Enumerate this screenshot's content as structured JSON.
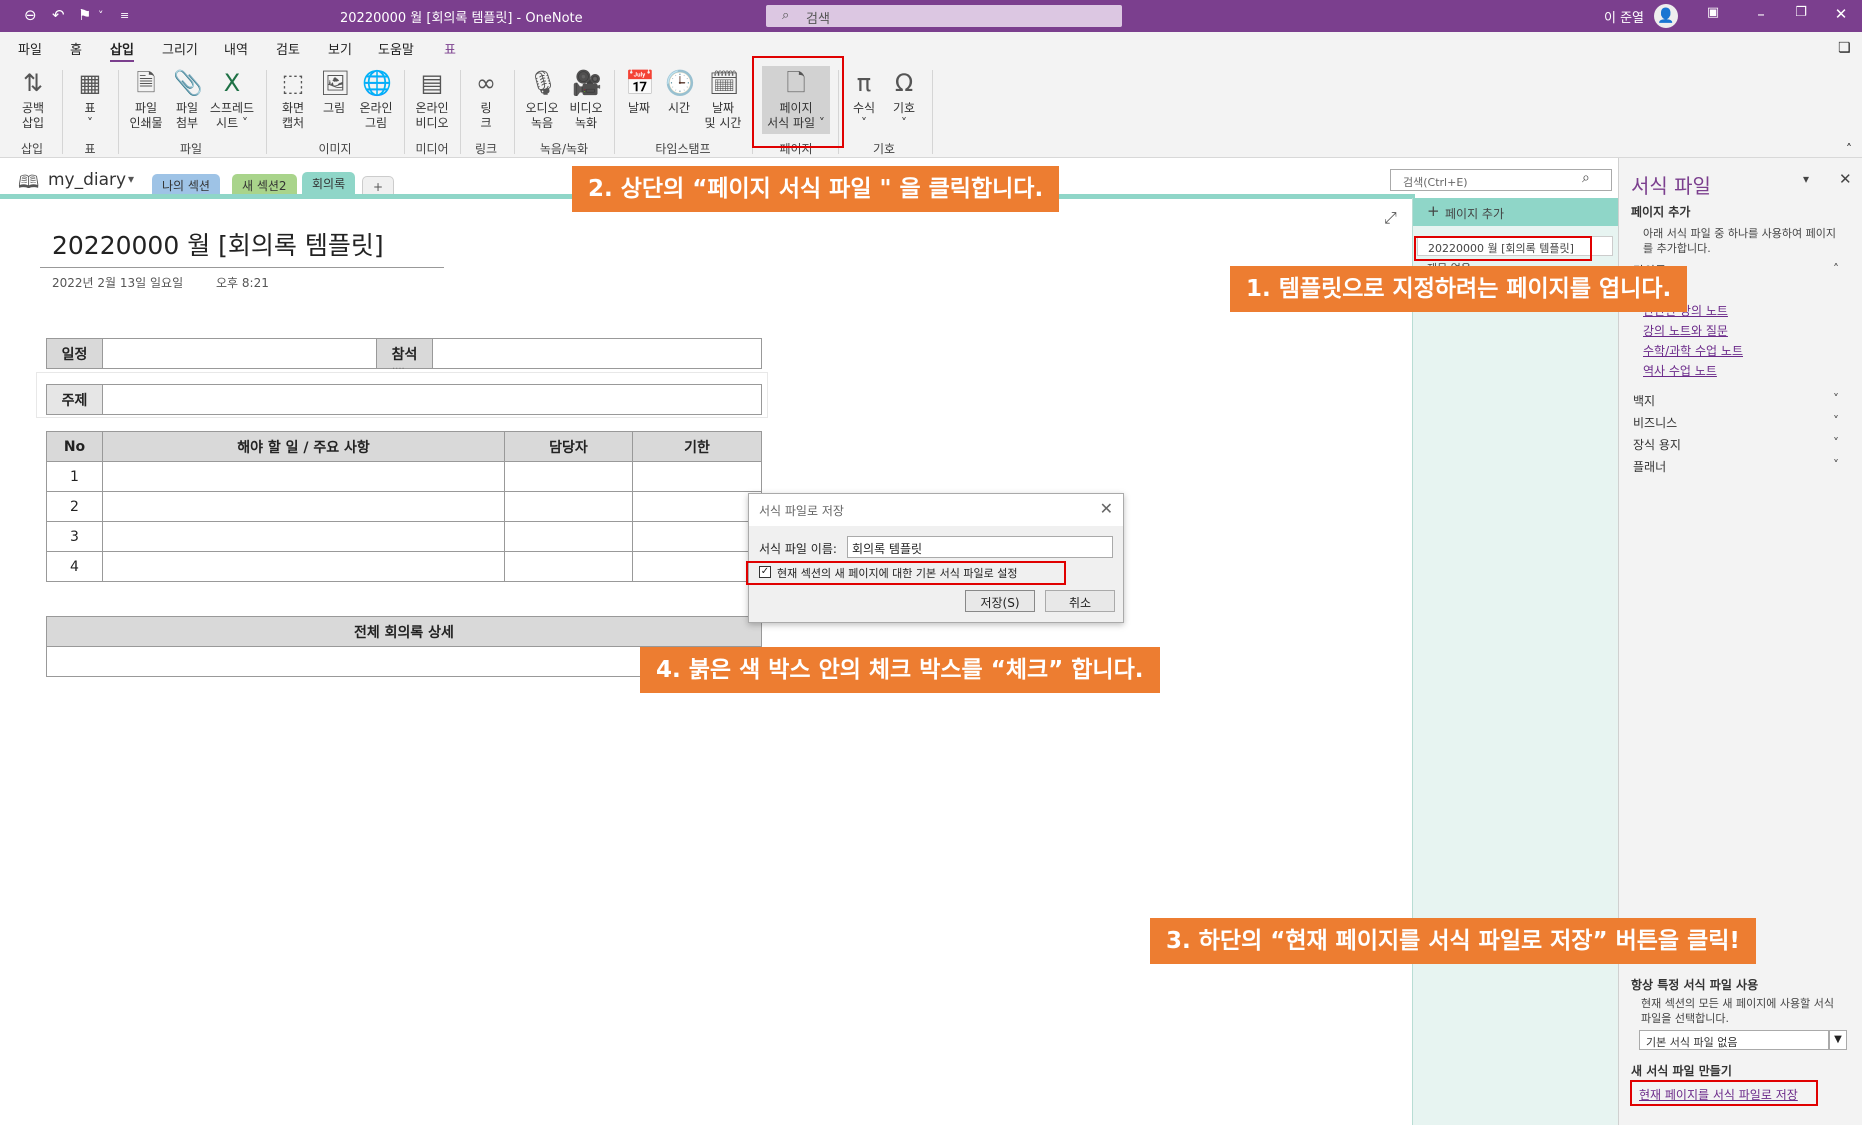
{
  "titlebar": {
    "document_title": "20220000 월 [회의록 템플릿] - OneNote",
    "search_placeholder": "검색",
    "user_name": "이 준열"
  },
  "menu": [
    "파일",
    "홈",
    "삽입",
    "그리기",
    "내역",
    "검토",
    "보기",
    "도움말",
    "표"
  ],
  "menu_active_index": 2,
  "ribbon": {
    "buttons": [
      {
        "label1": "공백",
        "label2": "삽입",
        "icon": "insert-space-icon"
      },
      {
        "label1": "표",
        "label2": "˅",
        "icon": "table-icon"
      },
      {
        "label1": "파일",
        "label2": "인쇄물",
        "icon": "file-printout-icon"
      },
      {
        "label1": "파일",
        "label2": "첨부",
        "icon": "attach-file-icon"
      },
      {
        "label1": "스프레드",
        "label2": "시트 ˅",
        "icon": "spreadsheet-icon"
      },
      {
        "label1": "화면",
        "label2": "캡처",
        "icon": "screen-clipping-icon"
      },
      {
        "label1": "그림",
        "label2": "",
        "icon": "picture-icon"
      },
      {
        "label1": "온라인",
        "label2": "그림",
        "icon": "online-picture-icon"
      },
      {
        "label1": "온라인",
        "label2": "비디오",
        "icon": "online-video-icon"
      },
      {
        "label1": "링",
        "label2": "크",
        "icon": "link-icon"
      },
      {
        "label1": "오디오",
        "label2": "녹음",
        "icon": "audio-record-icon"
      },
      {
        "label1": "비디오",
        "label2": "녹화",
        "icon": "video-record-icon"
      },
      {
        "label1": "날짜",
        "label2": "",
        "icon": "date-icon"
      },
      {
        "label1": "시간",
        "label2": "",
        "icon": "time-icon"
      },
      {
        "label1": "날짜",
        "label2": "및 시간",
        "icon": "date-time-icon"
      },
      {
        "label1": "페이지",
        "label2": "서식 파일 ˅",
        "icon": "page-template-icon"
      },
      {
        "label1": "수식",
        "label2": "˅",
        "icon": "equation-icon"
      },
      {
        "label1": "기호",
        "label2": "˅",
        "icon": "symbol-icon"
      }
    ],
    "groups": [
      "삽입",
      "표",
      "파일",
      "이미지",
      "미디어",
      "링크",
      "녹음/녹화",
      "타임스탬프",
      "페이지",
      "기호"
    ]
  },
  "notebook": {
    "name": "my_diary",
    "sections": [
      "나의 섹션",
      "새 섹션2",
      "회의록",
      "+"
    ]
  },
  "page": {
    "title": "20220000 월 [회의록 템플릿]",
    "date": "2022년 2월 13일 일요일",
    "time": "오후 8:21",
    "info_table": {
      "schedule_label": "일정",
      "attend_label": "참석",
      "subject_label": "주제",
      "divider": "····"
    },
    "task_table": {
      "headers": [
        "No",
        "해야 할 일 / 주요 사항",
        "담당자",
        "기한"
      ],
      "rows": [
        "1",
        "2",
        "3",
        "4"
      ]
    },
    "detail_header": "전체 회의록 상세"
  },
  "dialog": {
    "title": "서식 파일로 저장",
    "name_label": "서식 파일 이름:",
    "name_value": "회의록 템플릿",
    "checkbox_label": "현재 섹션의 새 페이지에 대한 기본 서식 파일로 설정",
    "checkbox_checked": true,
    "save_label": "저장(S)",
    "cancel_label": "취소"
  },
  "pagelist": {
    "search_placeholder": "검색(Ctrl+E)",
    "add_page": "페이지 추가",
    "pages": [
      "20220000 월 [회의록 템플릿]",
      "제목 없음"
    ]
  },
  "templates_pane": {
    "title": "서식 파일",
    "add_page_heading": "페이지 추가",
    "add_page_desc": "아래 서식 파일 중 하나를 사용하여 페이지를 추가합니다.",
    "category_lecture": "강의록",
    "lecture_links": [
      "간단한 강의 노트",
      "강의 노트와 질문",
      "수학/과학 수업 노트",
      "역사 수업 노트"
    ],
    "categories": [
      "백지",
      "비즈니스",
      "장식 용지",
      "플래너"
    ],
    "always_use_heading": "항상 특정 서식 파일 사용",
    "always_use_desc": "현재 섹션의 모든 새 페이지에 사용할 서식 파일을 선택합니다.",
    "default_select": "기본 서식 파일 없음",
    "new_template_heading": "새 서식 파일 만들기",
    "save_current_link": "현재 페이지를 서식 파일로 저장"
  },
  "callouts": {
    "step1": "1. 템플릿으로 지정하려는 페이지를 엽니다.",
    "step2": "2. 상단의 “페이지 서식 파일 \" 을 클릭합니다.",
    "step3": "3. 하단의 “현재 페이지를 서식 파일로 저장” 버튼을 클릭!",
    "step4": "4. 붉은 색 박스 안의 체크 박스를 “체크” 합니다."
  },
  "colors": {
    "onenote_purple": "#7b3f8e",
    "callout_orange": "#ed7d31",
    "highlight_red": "#e00000",
    "section_teal": "#8fd6c8"
  }
}
